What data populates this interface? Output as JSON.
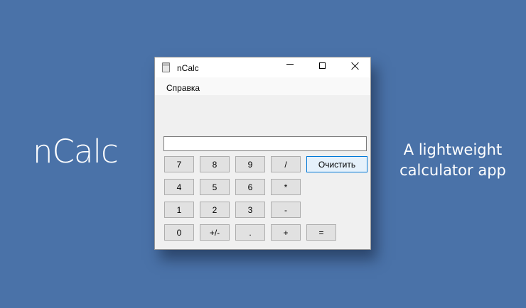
{
  "promo": {
    "title": "nCalc",
    "tagline_line1": "A lightweight",
    "tagline_line2": "calculator app"
  },
  "window": {
    "title": "nCalc",
    "icon": "calculator-icon",
    "controls": {
      "minimize": "minimize-icon",
      "maximize": "maximize-icon",
      "close": "close-icon"
    }
  },
  "menu": {
    "help": "Справка"
  },
  "display": {
    "value": ""
  },
  "keys": {
    "k7": "7",
    "k8": "8",
    "k9": "9",
    "div": "/",
    "clear": "Очистить",
    "k4": "4",
    "k5": "5",
    "k6": "6",
    "mul": "*",
    "k1": "1",
    "k2": "2",
    "k3": "3",
    "sub": "-",
    "k0": "0",
    "sign": "+/-",
    "dot": ".",
    "add": "+",
    "eq": "="
  },
  "colors": {
    "background": "#4a72a8",
    "window": "#f0f0f0",
    "accent": "#0078d7"
  }
}
